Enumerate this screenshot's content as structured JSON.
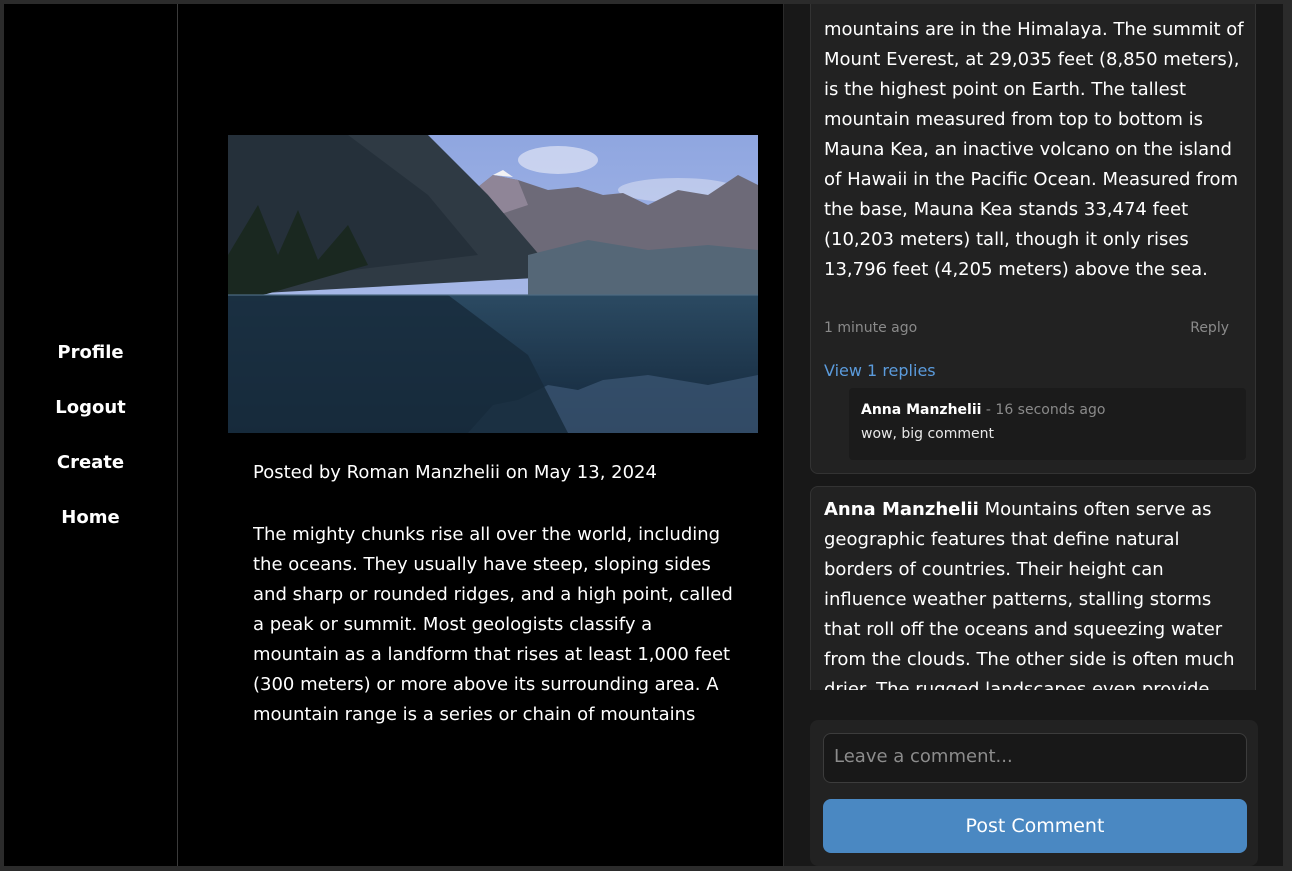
{
  "sidebar": {
    "items": [
      {
        "label": "Profile"
      },
      {
        "label": "Logout"
      },
      {
        "label": "Create"
      },
      {
        "label": "Home"
      }
    ]
  },
  "post": {
    "meta": "Posted by Roman Manzhelii on May 13, 2024",
    "body": "The mighty chunks rise all over the world, including the oceans. They usually have steep, sloping sides and sharp or rounded ridges, and a high point, called a peak or summit. Most geologists classify a mountain as a landform that rises at least 1,000 feet (300 meters) or more above its surrounding area. A mountain range is a series or chain of mountains that"
  },
  "comments": [
    {
      "text": "mountains are in the Himalaya. The summit of Mount Everest, at 29,035 feet (8,850 meters), is the highest point on Earth. The tallest mountain measured from top to bottom is Mauna Kea, an inactive volcano on the island of Hawaii in the Pacific Ocean. Measured from the base, Mauna Kea stands 33,474 feet (10,203 meters) tall, though it only rises 13,796 feet (4,205 meters) above the sea.",
      "time": "1 minute ago",
      "reply_label": "Reply",
      "view_replies": "View 1 replies",
      "reply": {
        "author": "Anna Manzhelii",
        "separator": "-",
        "time": "16 seconds ago",
        "text": "wow, big comment"
      }
    },
    {
      "author": "Anna Manzhelii",
      "text": "Mountains often serve as geographic features that define natural borders of countries. Their height can influence weather patterns, stalling storms that roll off the oceans and squeezing water from the clouds. The other side is often much drier. The rugged landscapes even provide refuge—and"
    }
  ],
  "composer": {
    "placeholder": "Leave a comment...",
    "button_label": "Post Comment"
  },
  "colors": {
    "accent": "#4a88c2",
    "link": "#5b9bdc",
    "background": "#000000",
    "panel": "#181818"
  }
}
